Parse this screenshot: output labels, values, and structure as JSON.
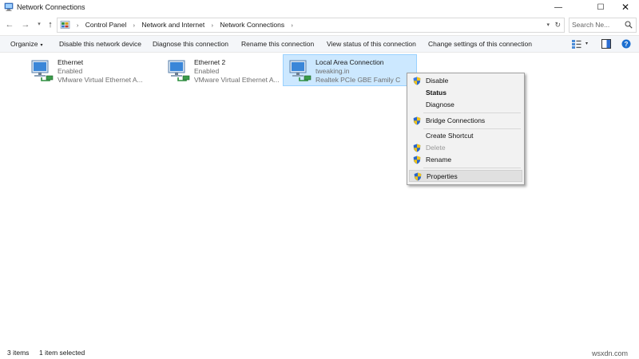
{
  "window": {
    "title": "Network Connections",
    "minimize_glyph": "—",
    "maximize_glyph": "☐",
    "close_glyph": "✕"
  },
  "nav": {
    "back_glyph": "←",
    "forward_glyph": "→",
    "recent_glyph": "▾",
    "up_glyph": "↑"
  },
  "address": {
    "breadcrumbs": [
      "Control Panel",
      "Network and Internet",
      "Network Connections"
    ],
    "separator": "›",
    "dropdown_glyph": "▾",
    "refresh_glyph": "↻"
  },
  "search": {
    "placeholder": "Search Ne..."
  },
  "toolbar": {
    "organize": "Organize",
    "disable_device": "Disable this network device",
    "diagnose": "Diagnose this connection",
    "rename": "Rename this connection",
    "view_status": "View status of this connection",
    "change_settings": "Change settings of this connection",
    "view_dropdown_glyph": "▾"
  },
  "connections": [
    {
      "name": "Ethernet",
      "status": "Enabled",
      "device": "VMware Virtual Ethernet A...",
      "selected": false
    },
    {
      "name": "Ethernet 2",
      "status": "Enabled",
      "device": "VMware Virtual Ethernet A...",
      "selected": false
    },
    {
      "name": "Local Area Connection",
      "status": "tweaking.in",
      "device": "Realtek PCIe GBE Family C",
      "selected": true
    }
  ],
  "context_menu": {
    "items": [
      {
        "label": "Disable",
        "shield": true,
        "bold": false,
        "disabled": false
      },
      {
        "label": "Status",
        "shield": false,
        "bold": true,
        "disabled": false
      },
      {
        "label": "Diagnose",
        "shield": false,
        "bold": false,
        "disabled": false
      },
      {
        "label": "Bridge Connections",
        "shield": true,
        "bold": false,
        "disabled": false
      },
      {
        "label": "Create Shortcut",
        "shield": false,
        "bold": false,
        "disabled": false
      },
      {
        "label": "Delete",
        "shield": true,
        "bold": false,
        "disabled": true
      },
      {
        "label": "Rename",
        "shield": true,
        "bold": false,
        "disabled": false
      },
      {
        "label": "Properties",
        "shield": true,
        "bold": false,
        "disabled": false,
        "highlighted": true
      }
    ]
  },
  "status_bar": {
    "item_count": "3 items",
    "selection": "1 item selected"
  },
  "watermark": "wsxdn.com",
  "colors": {
    "selection_bg": "#cce8ff",
    "selection_border": "#99d1ff",
    "toolbar_bg": "#f4f6f9",
    "menu_bg": "#f2f2f2",
    "help_blue": "#1c6fd0"
  }
}
